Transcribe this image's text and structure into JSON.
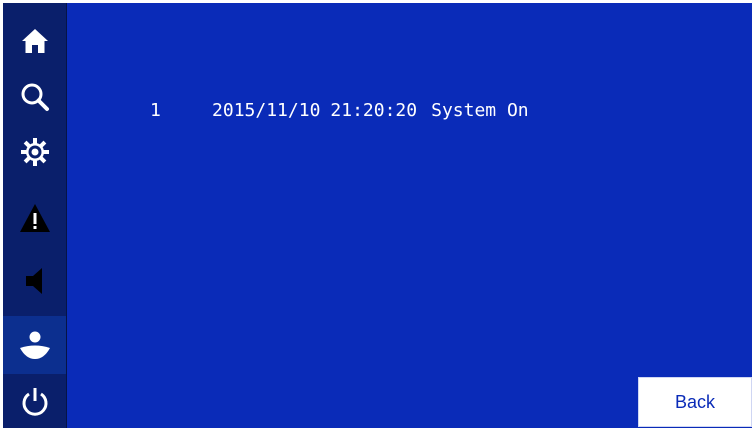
{
  "colors": {
    "sidebar_background": "#0a1f6b",
    "main_background": "#0a2bb8",
    "active_nav_background": "#0c2f8f",
    "icon_color": "#ffffff",
    "text_color": "#ffffff"
  },
  "sidebar": {
    "items": [
      {
        "icon": "home-icon"
      },
      {
        "icon": "search-icon"
      },
      {
        "icon": "gear-icon"
      },
      {
        "icon": "warning-icon"
      },
      {
        "icon": "speaker-icon"
      },
      {
        "icon": "user-icon",
        "active": true
      },
      {
        "icon": "power-icon"
      }
    ]
  },
  "log": {
    "entries": [
      {
        "index": "1",
        "date": "2015/11/10",
        "time": "21:20:20",
        "event": "System On"
      }
    ]
  },
  "footer": {
    "back_label": "Back"
  }
}
